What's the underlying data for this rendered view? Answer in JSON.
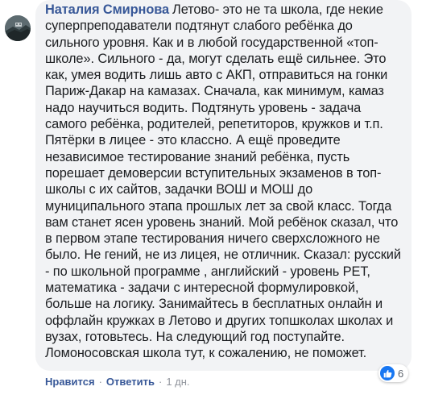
{
  "comment": {
    "author": "Наталия Смирнова",
    "text": "Летово- это не та школа, где некие суперпреподаватели подтянут слабого ребёнка до сильного уровня. Как и в любой государственной «топ-школе». Сильного - да, могут сделать ещё сильнее. Это как, умея водить лишь авто с АКП, отправиться на гонки Париж-Дакар на камазах. Сначала, как минимум, камаз надо научиться водить. Подтянуть уровень - задача самого ребёнка, родителей, репетиторов, кружков и т.п. Пятёрки в лицее - это классно. А ещё проведите независимое тестирование знаний ребёнка, пусть порешает демоверсии вступительных экзаменов в топ-школы с их сайтов, задачки ВОШ и МОШ до муниципального этапа прошлых лет за свой класс. Тогда вам станет ясен уровень знаний. Мой ребёнок сказал, что в первом этапе тестирования ничего сверхсложного не было. Не гений, не из лицея, не отличник. Сказал: русский - по школьной программе , английский - уровень PET, математика - задачи с интересной формулировкой, больше на логику. Занимайтесь в бесплатных онлайн и оффлайн кружках в Летово и других топшколах школах и вузах, готовьтесь. На следующий год поступайте. Ломоносовская школа тут, к сожалению, не поможет."
  },
  "reactions": {
    "icon": "like-thumb-icon",
    "count": "6",
    "color": "#1877f2"
  },
  "actions": {
    "like_label": "Нравится",
    "reply_label": "Ответить",
    "separator": "·",
    "timestamp": "1 дн."
  },
  "colors": {
    "bubble": "#f2f3f5",
    "author": "#385898",
    "text": "#1c1e21",
    "meta": "#90949c"
  }
}
